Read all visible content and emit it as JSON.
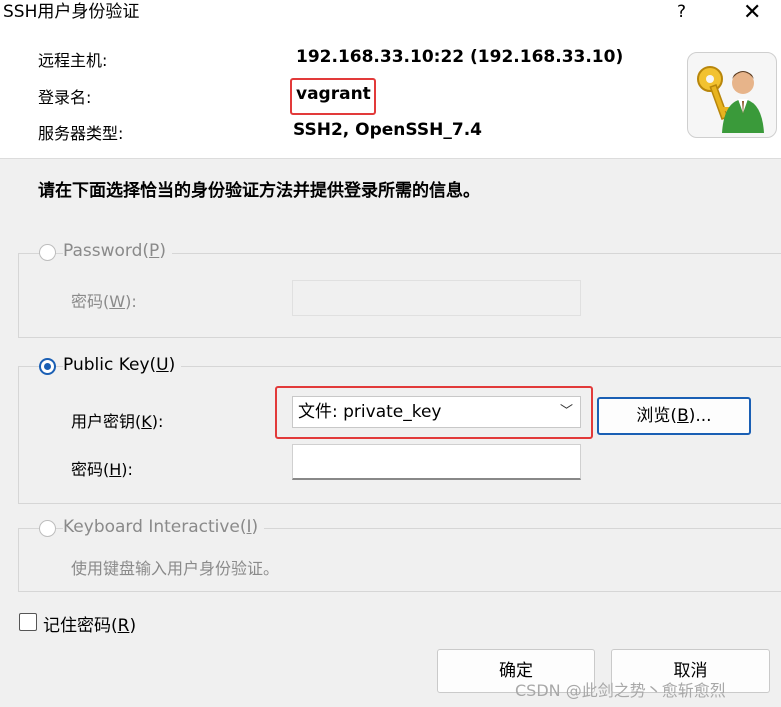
{
  "window": {
    "title": "SSH用户身份验证",
    "help_label": "?",
    "close_label": "✕"
  },
  "info": {
    "host_label": "远程主机:",
    "host_value": "192.168.33.10:22 (192.168.33.10)",
    "login_label": "登录名:",
    "login_value": "vagrant",
    "server_label": "服务器类型:",
    "server_value": "SSH2, OpenSSH_7.4"
  },
  "instruction": "请在下面选择恰当的身份验证方法并提供登录所需的信息。",
  "password_group": {
    "radio_text": "Password(",
    "radio_key": "P",
    "radio_end": ")",
    "field_text": "密码(",
    "field_key": "W",
    "field_end": "):"
  },
  "pubkey_group": {
    "radio_text": "Public Key(",
    "radio_key": "U",
    "radio_end": ")",
    "key_label_text": "用户密钥(",
    "key_label_key": "K",
    "key_label_end": "):",
    "key_value": "文件: private_key",
    "browse_text": "浏览(",
    "browse_key": "B",
    "browse_end": ")...",
    "pass_label_text": "密码(",
    "pass_label_key": "H",
    "pass_label_end": "):",
    "pass_value": ""
  },
  "keyboard_group": {
    "radio_text": "Keyboard Interactive(",
    "radio_key": "I",
    "radio_end": ")",
    "description": "使用键盘输入用户身份验证。"
  },
  "remember": {
    "text": "记住密码(",
    "key": "R",
    "end": ")",
    "checked": false
  },
  "buttons": {
    "ok": "确定",
    "cancel": "取消"
  },
  "watermark": "CSDN @此剑之势丶愈斩愈烈",
  "colors": {
    "accent": "#1a5fb4",
    "highlight": "#e23a3a"
  }
}
